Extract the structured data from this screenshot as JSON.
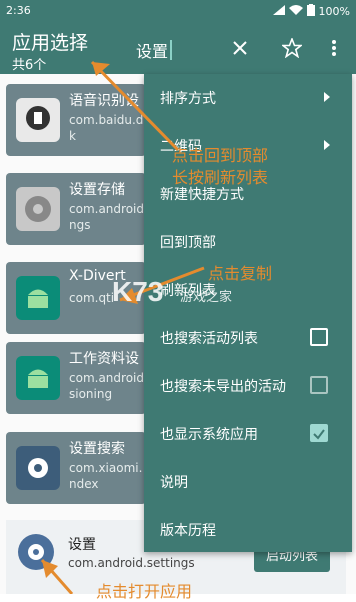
{
  "status": {
    "time": "2:36",
    "battery": "100%"
  },
  "appbar": {
    "title": "应用选择",
    "subtitle": "共6个",
    "search_text": "设置"
  },
  "cards": [
    {
      "name": "语音识别设",
      "pkg": "com.baidu.d\nk",
      "icon": "microphone-icon"
    },
    {
      "name": "设置存储",
      "pkg": "com.android\nngs",
      "icon": "gear-icon"
    },
    {
      "name": "X-Divert",
      "pkg": "com.qti",
      "icon": "android-icon"
    },
    {
      "name": "工作资料设",
      "pkg": "com.android\nsioning",
      "icon": "android-icon"
    },
    {
      "name": "设置搜索",
      "pkg": "com.xiaomi.\nndex",
      "icon": "gear-icon"
    }
  ],
  "last_row": {
    "name": "设置",
    "pkg": "com.android.settings",
    "launch_label": "启动列表"
  },
  "menu": {
    "sort": "排序方式",
    "qrcode": "二维码",
    "new_shortcut": "新建快捷方式",
    "back_top": "回到顶部",
    "refresh": "刷新列表",
    "search_activity": "也搜索活动列表",
    "search_unexported": "也搜索未导出的活动",
    "show_system": "也显示系统应用",
    "help": "说明",
    "history": "版本历程"
  },
  "annotations": {
    "top1": "点击回到顶部",
    "top2": "长按刷新列表",
    "copy": "点击复制",
    "bottom": "点击打开应用"
  },
  "watermark": {
    "logo": "K73",
    "site": "游戏之家"
  }
}
